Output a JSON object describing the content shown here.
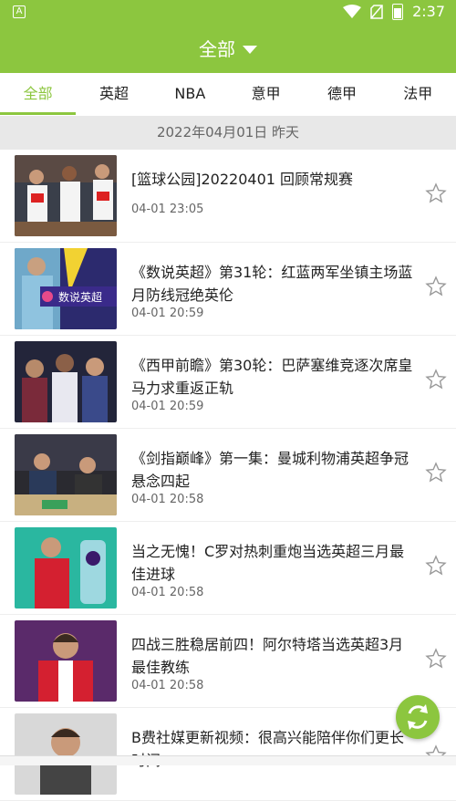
{
  "status_bar": {
    "app_icon": "A",
    "time": "2:37"
  },
  "header": {
    "title": "全部"
  },
  "tabs": [
    {
      "label": "全部",
      "active": true
    },
    {
      "label": "英超",
      "active": false
    },
    {
      "label": "NBA",
      "active": false
    },
    {
      "label": "意甲",
      "active": false
    },
    {
      "label": "德甲",
      "active": false
    },
    {
      "label": "法甲",
      "active": false
    }
  ],
  "date_bar": "2022年04月01日 昨天",
  "items": [
    {
      "title": "[篮球公园]20220401 回顾常规赛",
      "time": "04-01 23:05"
    },
    {
      "title": "《数说英超》第31轮：红蓝两军坐镇主场蓝月防线冠绝英伦",
      "time": "04-01 20:59"
    },
    {
      "title": "《西甲前瞻》第30轮：巴萨塞维竞逐次席皇马力求重返正轨",
      "time": "04-01 20:59"
    },
    {
      "title": "《剑指巅峰》第一集：曼城利物浦英超争冠悬念四起",
      "time": "04-01 20:58"
    },
    {
      "title": "当之无愧！C罗对热刺重炮当选英超三月最佳进球",
      "time": "04-01 20:58"
    },
    {
      "title": "四战三胜稳居前四！阿尔特塔当选英超3月最佳教练",
      "time": "04-01 20:58"
    },
    {
      "title": "B费社媒更新视频：很高兴能陪伴你们更长时间",
      "time": ""
    }
  ],
  "colors": {
    "accent": "#8cc63f",
    "date_bar_bg": "#e8e8e8"
  },
  "icons": {
    "star": "star-outline-icon",
    "refresh": "refresh-icon"
  }
}
